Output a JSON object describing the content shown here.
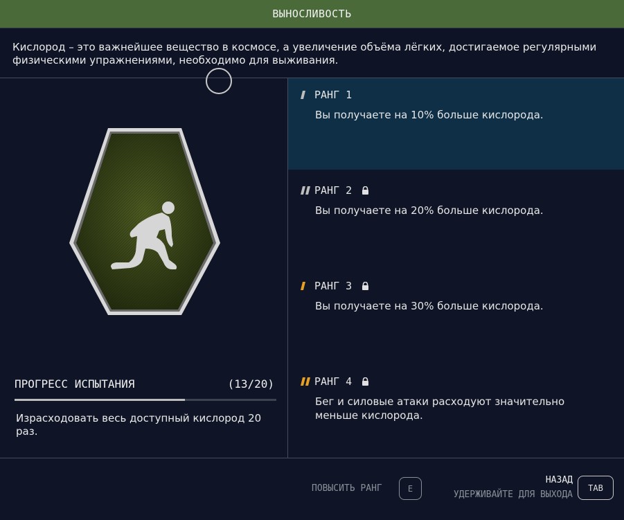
{
  "header": {
    "title": "ВЫНОСЛИВОСТЬ"
  },
  "description": "Кислород – это важнейшее вещество в космосе, а увеличение объёма лёгких, достигаемое регулярными физическими упражнениями, необходимо для выживания.",
  "badge": {
    "icon": "runner-starting-pose-icon",
    "color": "#3d4a1c"
  },
  "progress": {
    "title": "ПРОГРЕСС ИСПЫТАНИЯ",
    "count": "(13/20)",
    "current": 13,
    "total": 20,
    "description": "Израсходовать весь доступный кислород 20 раз."
  },
  "ranks": [
    {
      "title": "РАНГ 1",
      "text": "Вы получаете на 10% больше кислорода.",
      "locked": false,
      "active": true,
      "mark_color": "#bdbdbd"
    },
    {
      "title": "РАНГ 2",
      "text": "Вы получаете на 20% больше кислорода.",
      "locked": true,
      "active": false,
      "mark_color": "#bdbdbd"
    },
    {
      "title": "РАНГ 3",
      "text": "Вы получаете на 30% больше кислорода.",
      "locked": true,
      "active": false,
      "mark_color": "#e8a020"
    },
    {
      "title": "РАНГ 4",
      "text": "Бег и силовые атаки расходуют значительно меньше кислорода.",
      "locked": true,
      "active": false,
      "mark_color": "#e8a020"
    }
  ],
  "footer": {
    "rank_up_label": "ПОВЫСИТЬ РАНГ",
    "rank_up_key": "E",
    "back_label": "НАЗАД",
    "hold_label": "УДЕРЖИВАЙТЕ ДЛЯ ВЫХОДА",
    "back_key": "TAB"
  },
  "colors": {
    "header": "#4a6a3a",
    "active_rank": "#0f2f47",
    "background": "#0f1526"
  }
}
